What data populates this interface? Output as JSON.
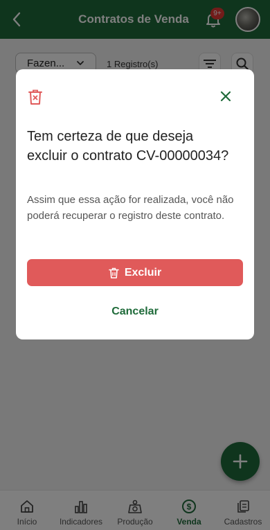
{
  "header": {
    "title": "Contratos de Venda",
    "notification_badge": "9+"
  },
  "toolbar": {
    "farm_select_value": "Fazen...",
    "records_count": "1 Registro(s)"
  },
  "bottom_nav": {
    "items": [
      {
        "label": "Início",
        "icon": "home-icon"
      },
      {
        "label": "Indicadores",
        "icon": "bar-chart-icon"
      },
      {
        "label": "Produção",
        "icon": "scale-icon"
      },
      {
        "label": "Venda",
        "icon": "dollar-circle-icon"
      },
      {
        "label": "Cadastros",
        "icon": "stacked-cards-icon"
      }
    ],
    "active_index": 3
  },
  "modal": {
    "title": "Tem certeza de que deseja excluir o contrato CV-00000034?",
    "message": "Assim que essa ação for realizada, você não poderá recuperar o registro deste contrato.",
    "delete_label": "Excluir",
    "cancel_label": "Cancelar"
  },
  "colors": {
    "primary": "#1f6b3a",
    "danger": "#e05a5a",
    "badge": "#e53935"
  }
}
